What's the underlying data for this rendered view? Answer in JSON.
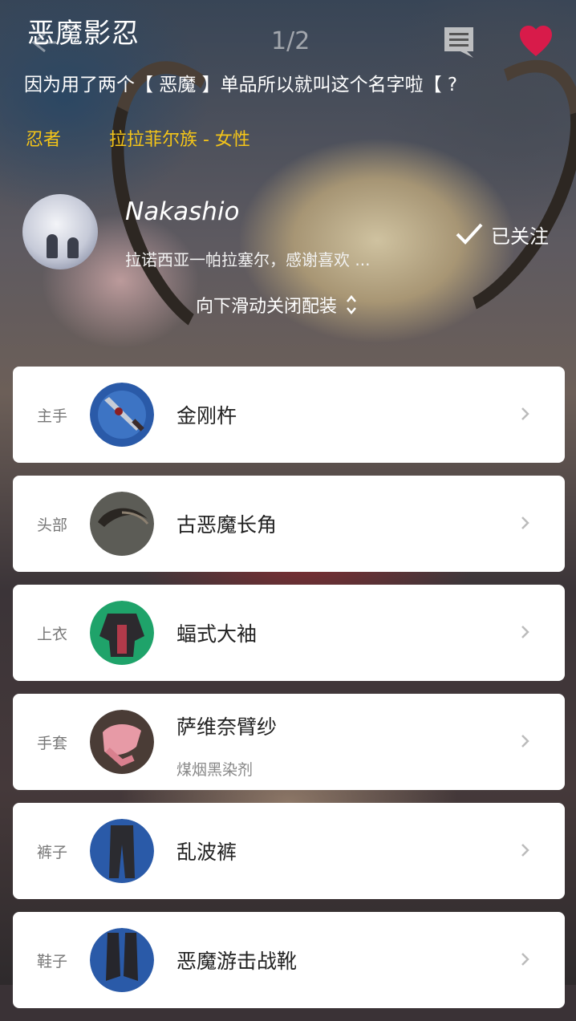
{
  "header": {
    "title": "恶魔影忍",
    "page_indicator": "1/2"
  },
  "description": "因为用了两个【 恶魔 】单品所以就叫这个名字啦【 ?",
  "tags": {
    "job": "忍者",
    "race": "拉拉菲尔族 - 女性"
  },
  "author": {
    "name": "Nakashio",
    "bio": "拉诺西亚一帕拉塞尔，感谢喜欢 ...",
    "follow_label": "已关注"
  },
  "swipe_hint": "向下滑动关闭配装",
  "colors": {
    "tag": "#f5c518",
    "heart": "#d81b4a",
    "card": "#ffffff"
  },
  "equipment": [
    {
      "slot": "主手",
      "name": "金刚杵",
      "dye": "",
      "icon": "dagger-icon"
    },
    {
      "slot": "头部",
      "name": "古恶魔长角",
      "dye": "",
      "icon": "horn-icon"
    },
    {
      "slot": "上衣",
      "name": "蝠式大袖",
      "dye": "",
      "icon": "robe-icon"
    },
    {
      "slot": "手套",
      "name": "萨维奈臂纱",
      "dye": "煤烟黑染剂",
      "icon": "glove-icon"
    },
    {
      "slot": "裤子",
      "name": "乱波裤",
      "dye": "",
      "icon": "pants-icon"
    },
    {
      "slot": "鞋子",
      "name": "恶魔游击战靴",
      "dye": "",
      "icon": "boots-icon"
    }
  ]
}
